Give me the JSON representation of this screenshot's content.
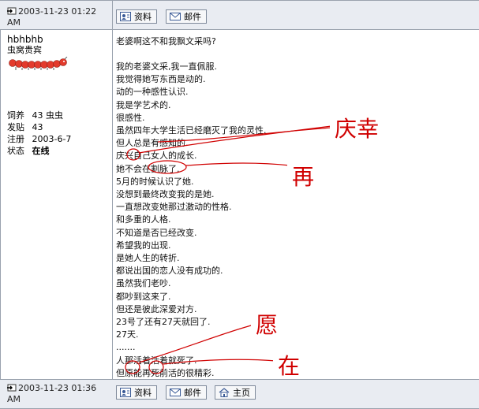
{
  "top_post": {
    "timestamp": "2003-11-23 01:22 AM",
    "buttons": [
      {
        "label": "资料"
      },
      {
        "label": "邮件"
      }
    ]
  },
  "main_post": {
    "author": {
      "name": "hbhbhb",
      "title": "虫窝贵宾",
      "stats": [
        {
          "label": "饲养",
          "value": "43 虫虫"
        },
        {
          "label": "发贴",
          "value": "43"
        },
        {
          "label": "注册",
          "value": "2003-6-7"
        },
        {
          "label": "状态",
          "value": "在线"
        }
      ]
    },
    "title_line": "老婆啊这不和我飘文采吗?",
    "lines": [
      "我的老婆文采,我一直佩服.",
      "我觉得她写东西是动的.",
      "动的一种感性认识.",
      "我是学艺术的.",
      "很感性.",
      "虽然四年大学生活已经磨灭了我的灵性.",
      "但人总是有感知的.",
      "庆兴自己女人的成长.",
      "她不会在割脉了.",
      "5月的时候认识了她.",
      "没想到最终改变我的是她.",
      "一直想改变她那过激动的性格.",
      "和多重的人格.",
      "不知道是否已经改变.",
      "希望我的出现.",
      "是她人生的转折.",
      "都说出国的恋人没有成功的.",
      "虽然我们老吵.",
      "都吵到这来了.",
      "但还是彼此深爱对方.",
      "23号了还有27天就回了.",
      "27天.",
      ".......",
      "人那活着活着就死了.",
      "但原能再死前活的很精彩."
    ],
    "annotations": [
      {
        "text": "庆幸"
      },
      {
        "text": "再"
      },
      {
        "text": "愿"
      },
      {
        "text": "在"
      }
    ]
  },
  "bottom_post": {
    "timestamp": "2003-11-23 01:36 AM",
    "buttons": [
      {
        "label": "资料"
      },
      {
        "label": "邮件"
      },
      {
        "label": "主页"
      }
    ]
  },
  "colors": {
    "bar_bg": "#e9ecf2",
    "border": "#9aa2ae",
    "annotation": "#d00000"
  },
  "icons": {
    "post": "post-arrow-icon",
    "profile": "profile-icon",
    "mail": "mail-icon",
    "home": "home-icon",
    "avatar_rank": "rank-caterpillar-icon"
  }
}
